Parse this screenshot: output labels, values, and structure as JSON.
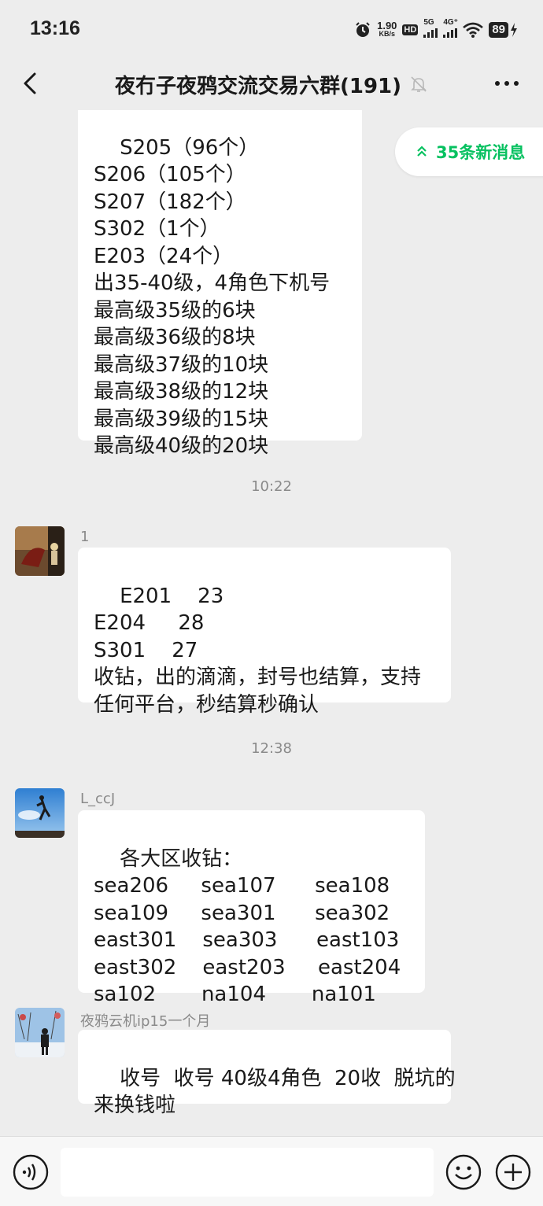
{
  "status_bar": {
    "time": "13:16",
    "net_speed_value": "1.90",
    "net_speed_unit": "KB/s",
    "hd_label": "HD",
    "net1": "5G",
    "net2": "4G⁺",
    "battery": "89"
  },
  "header": {
    "title": "夜冇子夜鸦交流交易六群(191)"
  },
  "new_messages": {
    "label": "35条新消息"
  },
  "messages": [
    {
      "text": "S205（96个）\nS206（105个）\nS207（182个）\nS302（1个）\nE203（24个）\n出35-40级，4角色下机号\n最高级35级的6块\n最高级36级的8块\n最高级37级的10块\n最高级38级的12块\n最高级39级的15块\n最高级40级的20块"
    },
    {
      "timestamp": "10:22"
    },
    {
      "sender": "1",
      "text": "E201    23\nE204     28\nS301    27\n收钻，出的滴滴，封号也结算，支持\n任何平台，秒结算秒确认"
    },
    {
      "timestamp": "12:38"
    },
    {
      "sender": "L_ccJ",
      "text": "各大区收钻：\nsea206     sea107      sea108\nsea109     sea301      sea302\neast301    sea303      east103\neast302    east203     east204\nsa102       na104       na101"
    },
    {
      "sender": "夜鸦云机ip15一个月",
      "text": "收号  收号 40级4角色  20收  脱坑的\n来换钱啦"
    }
  ],
  "colors": {
    "background": "#ededed",
    "bubble": "#ffffff",
    "accent_green": "#07c160",
    "meta_gray": "#8a8a8a"
  },
  "icons": [
    "back-arrow-icon",
    "mute-bell-icon",
    "more-icon",
    "double-chevron-up-icon",
    "voice-icon",
    "emoji-icon",
    "plus-icon"
  ]
}
